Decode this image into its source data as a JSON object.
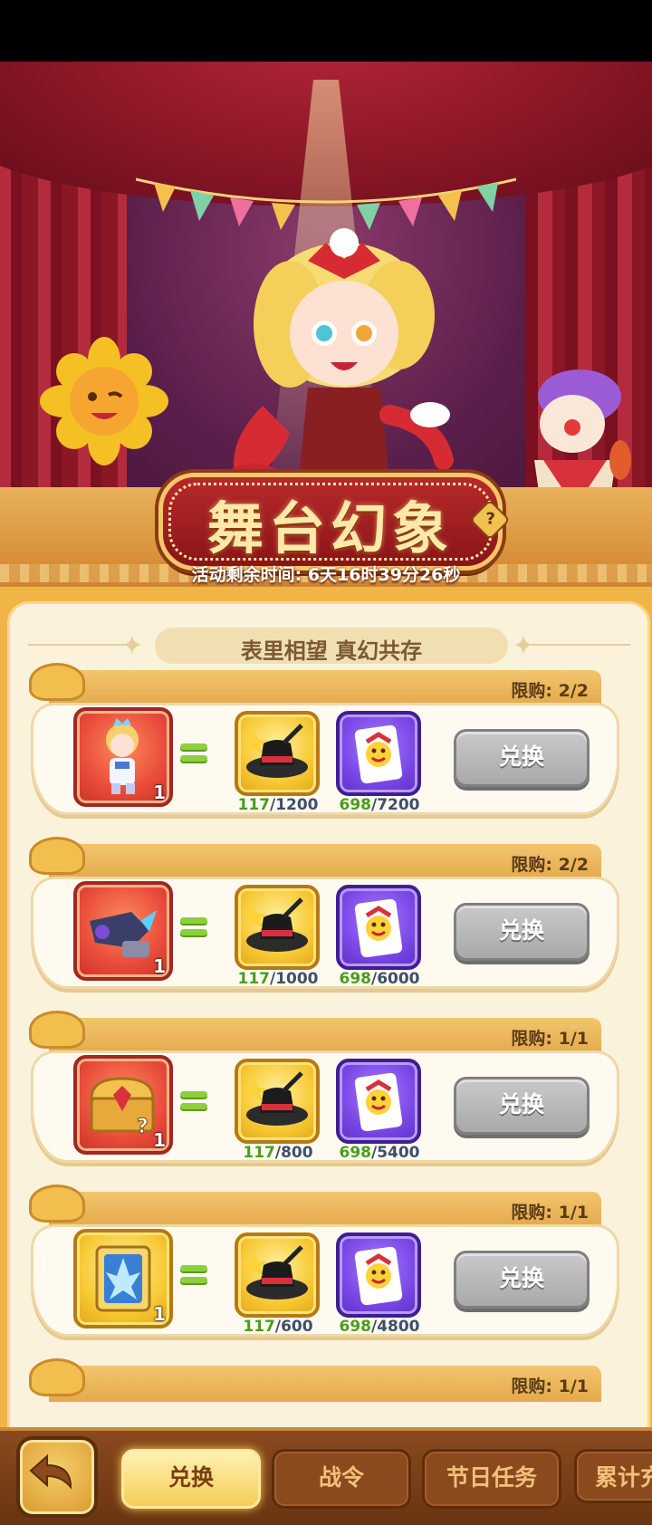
{
  "banner": {
    "title": "舞台幻象",
    "help_icon": "?",
    "timer_text": "活动剩余时间: 6天16时39分26秒"
  },
  "panel": {
    "subtitle": "表里相望 真幻共存"
  },
  "items": [
    {
      "limit": "限购: 2/2",
      "reward_icon": "prince-character-icon",
      "reward_qty": "1",
      "cost1": {
        "icon": "magic-hat-icon",
        "have": "117",
        "need": "/1200"
      },
      "cost2": {
        "icon": "joker-card-icon",
        "have": "698",
        "need": "/7200"
      },
      "button": "兑换"
    },
    {
      "limit": "限购: 2/2",
      "reward_icon": "mech-weapon-icon",
      "reward_qty": "1",
      "cost1": {
        "icon": "magic-hat-icon",
        "have": "117",
        "need": "/1000"
      },
      "cost2": {
        "icon": "joker-card-icon",
        "have": "698",
        "need": "/6000"
      },
      "button": "兑换"
    },
    {
      "limit": "限购: 1/1",
      "reward_icon": "treasure-chest-icon",
      "reward_qty": "1",
      "cost1": {
        "icon": "magic-hat-icon",
        "have": "117",
        "need": "/800"
      },
      "cost2": {
        "icon": "joker-card-icon",
        "have": "698",
        "need": "/5400"
      },
      "button": "兑换"
    },
    {
      "limit": "限购: 1/1",
      "reward_icon": "ice-crystal-card-icon",
      "reward_qty": "1",
      "cost1": {
        "icon": "magic-hat-icon",
        "have": "117",
        "need": "/600"
      },
      "cost2": {
        "icon": "joker-card-icon",
        "have": "698",
        "need": "/4800"
      },
      "button": "兑换"
    },
    {
      "limit": "限购: 1/1"
    }
  ],
  "nav": {
    "back_icon": "back-arrow-icon",
    "tabs": [
      "兑换",
      "战令",
      "节日任务",
      "累计充"
    ],
    "active_tab": "兑换"
  }
}
